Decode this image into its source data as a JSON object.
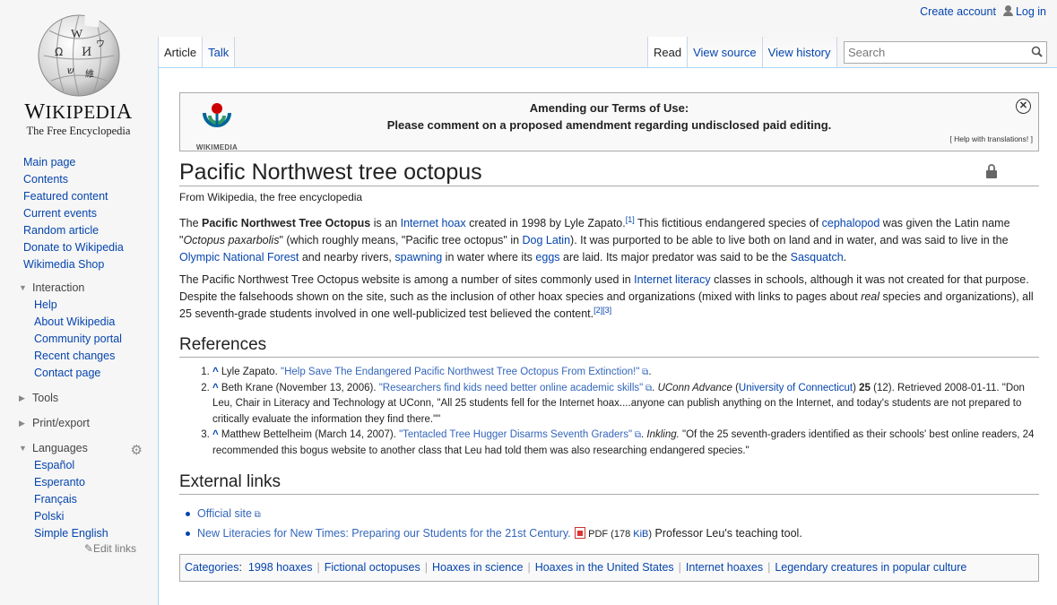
{
  "personal": {
    "create_account": "Create account",
    "login": "Log in"
  },
  "logo": {
    "wordmark_big_w": "W",
    "wordmark_ikipedi": "IKIPEDI",
    "wordmark_big_a": "A",
    "tagline": "The Free Encyclopedia"
  },
  "nav": {
    "main": [
      "Main page",
      "Contents",
      "Featured content",
      "Current events",
      "Random article",
      "Donate to Wikipedia",
      "Wikimedia Shop"
    ],
    "interaction": {
      "heading": "Interaction",
      "items": [
        "Help",
        "About Wikipedia",
        "Community portal",
        "Recent changes",
        "Contact page"
      ]
    },
    "tools": "Tools",
    "print": "Print/export",
    "languages": {
      "heading": "Languages",
      "items": [
        "Español",
        "Esperanto",
        "Français",
        "Polski",
        "Simple English"
      ],
      "edit_links": "Edit links"
    }
  },
  "tabs": {
    "article": "Article",
    "talk": "Talk",
    "read": "Read",
    "view_source": "View source",
    "view_history": "View history"
  },
  "search": {
    "placeholder": "Search"
  },
  "banner": {
    "logo_text": "WIKIMEDIA",
    "line1": "Amending our Terms of Use:",
    "line2": "Please comment on a proposed amendment regarding undisclosed paid editing.",
    "help": "[ Help with translations! ]"
  },
  "article": {
    "title": "Pacific Northwest tree octopus",
    "subtitle": "From Wikipedia, the free encyclopedia",
    "p1": {
      "t1": "The ",
      "bold": "Pacific Northwest Tree Octopus",
      "t2": " is an ",
      "l_internet_hoax": "Internet hoax",
      "t3": " created in 1998 by Lyle Zapato.",
      "sup1": "[1]",
      "t4": " This fictitious endangered species of ",
      "l_cephalopod": "cephalopod",
      "t5": " was given the Latin name \"",
      "italic": "Octopus paxarbolis",
      "t6": "\" (which roughly means, \"Pacific tree octopus\" in ",
      "l_dog_latin": "Dog Latin",
      "t7": "). It was purported to be able to live both on land and in water, and was said to live in the ",
      "l_olympic": "Olympic National Forest",
      "t8": " and nearby rivers, ",
      "l_spawning": "spawning",
      "t9": " in water where its ",
      "l_eggs": "eggs",
      "t10": " are laid. Its major predator was said to be the ",
      "l_sasquatch": "Sasquatch",
      "t11": "."
    },
    "p2": {
      "t1": "The Pacific Northwest Tree Octopus website is among a number of sites commonly used in ",
      "l_literacy": "Internet literacy",
      "t2": " classes in schools, although it was not created for that purpose. Despite the falsehoods shown on the site, such as the inclusion of other hoax species and organizations (mixed with links to pages about ",
      "italic": "real",
      "t3": " species and organizations), all 25 seventh-grade students involved in one well-publicized test believed the content.",
      "sup": "[2][3]"
    }
  },
  "references": {
    "heading": "References",
    "items": [
      {
        "caret": "^",
        "before": " Lyle Zapato. ",
        "link": "\"Help Save The Endangered Pacific Northwest Tree Octopus From Extinction!\"",
        "after": "."
      },
      {
        "caret": "^",
        "before": " Beth Krane (November 13, 2006). ",
        "link": "\"Researchers find kids need better online academic skills\"",
        "mid1": ". ",
        "italic": "UConn Advance",
        "mid2": " (",
        "link2": "University of Connecticut",
        "mid3": ") ",
        "bold": "25",
        "after": " (12). Retrieved 2008-01-11. \"Don Leu, Chair in Literacy and Technology at UConn, \"All 25 students fell for the Internet hoax....anyone can publish anything on the Internet, and today's students are not prepared to critically evaluate the information they find there.\"\""
      },
      {
        "caret": "^",
        "before": " Matthew Bettelheim (March 14, 2007). ",
        "link": "\"Tentacled Tree Hugger Disarms Seventh Graders\"",
        "mid1": ". ",
        "italic": "Inkling.",
        "after": " \"Of the 25 seventh-graders identified as their schools' best online readers, 24 recommended this bogus website to another class that Leu had told them was also researching endangered species.\""
      }
    ]
  },
  "external": {
    "heading": "External links",
    "official": "Official site",
    "literacies": "New Literacies for New Times: Preparing our Students for the 21st Century.",
    "pdf": "PDF",
    "size_open": " (178 ",
    "size_unit": "KiB",
    "size_close": ")",
    "desc": " Professor Leu's teaching tool."
  },
  "categories": {
    "label": "Categories",
    "colon": ":",
    "items": [
      "1998 hoaxes",
      "Fictional octopuses",
      "Hoaxes in science",
      "Hoaxes in the United States",
      "Internet hoaxes",
      "Legendary creatures in popular culture"
    ]
  },
  "colors": {
    "link": "#0645ad",
    "visited": "#663366",
    "external": "#3366bb",
    "border": "#a7d7f9"
  }
}
